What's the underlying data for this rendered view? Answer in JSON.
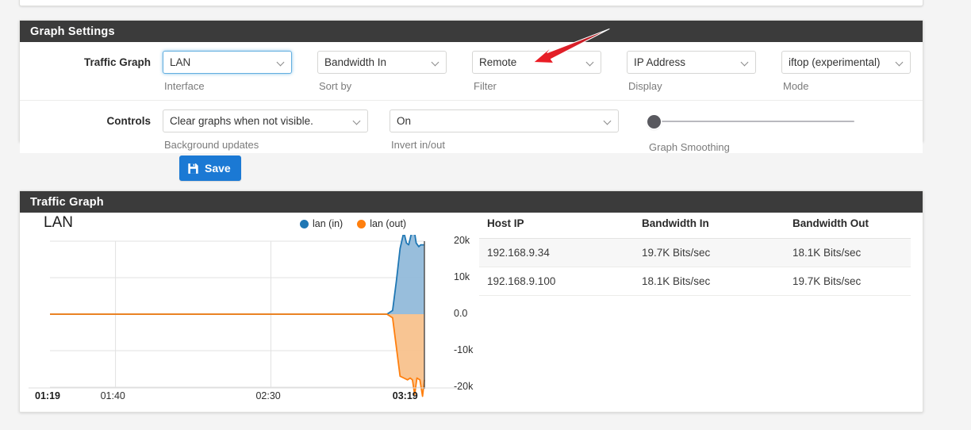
{
  "settings_panel": {
    "title": "Graph Settings",
    "rows": [
      {
        "label": "Traffic Graph",
        "fields": [
          {
            "value": "LAN",
            "caption": "Interface",
            "name": "interface"
          },
          {
            "value": "Bandwidth In",
            "caption": "Sort by",
            "name": "sort-by"
          },
          {
            "value": "Remote",
            "caption": "Filter",
            "name": "filter"
          },
          {
            "value": "IP Address",
            "caption": "Display",
            "name": "display"
          },
          {
            "value": "iftop (experimental)",
            "caption": "Mode",
            "name": "mode"
          }
        ]
      },
      {
        "label": "Controls",
        "fields": [
          {
            "value": "Clear graphs when not visible.",
            "caption": "Background updates",
            "name": "background-updates"
          },
          {
            "value": "On",
            "caption": "Invert in/out",
            "name": "invert-in-out"
          },
          {
            "value": "",
            "caption": "Graph Smoothing",
            "name": "graph-smoothing"
          }
        ]
      }
    ]
  },
  "save_button": {
    "label": "Save",
    "icon": "save-floppy-icon",
    "color": "#1b79d4"
  },
  "annotation": {
    "type": "red-arrow",
    "color": "#e8232a",
    "points_to": "filter"
  },
  "graph_panel": {
    "title": "Traffic Graph",
    "interface_label": "LAN",
    "legend": [
      {
        "label": "lan (in)",
        "color": "#1f77b4"
      },
      {
        "label": "lan (out)",
        "color": "#ff7f0e"
      }
    ],
    "table": {
      "headers": [
        "Host IP",
        "Bandwidth In",
        "Bandwidth Out"
      ],
      "rows": [
        [
          "192.168.9.34",
          "19.7K Bits/sec",
          "18.1K Bits/sec"
        ],
        [
          "192.168.9.100",
          "18.1K Bits/sec",
          "19.7K Bits/sec"
        ]
      ]
    }
  },
  "chart_data": {
    "type": "area",
    "title": "LAN",
    "xlabel": "",
    "ylabel": "",
    "ylim": [
      -20000,
      20000
    ],
    "yticks": [
      20000,
      10000,
      0,
      -10000,
      -20000
    ],
    "ytick_labels": [
      "20k",
      "10k",
      "0.0",
      "-10k",
      "-20k"
    ],
    "xticks": [
      "01:19",
      "01:40",
      "02:30",
      "03:19"
    ],
    "xtick_positions": [
      0.0,
      0.175,
      0.59,
      0.955
    ],
    "grid": true,
    "legend_position": "top-right",
    "series": [
      {
        "name": "lan (in)",
        "color": "#1f77b4",
        "fill": "#8fb9d9",
        "x": [
          0.0,
          0.9,
          0.915,
          0.925,
          0.935,
          0.945,
          0.952,
          0.958,
          0.965,
          0.972,
          0.978,
          0.985,
          0.99,
          1.0
        ],
        "values": [
          0,
          0,
          1000,
          9000,
          18000,
          22500,
          19500,
          19000,
          22000,
          23500,
          19500,
          18500,
          19000,
          19000
        ]
      },
      {
        "name": "lan (out)",
        "color": "#ff7f0e",
        "fill": "#f7c08a",
        "x": [
          0.0,
          0.9,
          0.915,
          0.925,
          0.935,
          0.945,
          0.955,
          0.962,
          0.968,
          0.974,
          0.98,
          0.988,
          0.995,
          1.0
        ],
        "values": [
          0,
          0,
          -1000,
          -9000,
          -17000,
          -17500,
          -18000,
          -17500,
          -18000,
          -22000,
          -17500,
          -18000,
          -22500,
          -18000
        ]
      }
    ]
  }
}
